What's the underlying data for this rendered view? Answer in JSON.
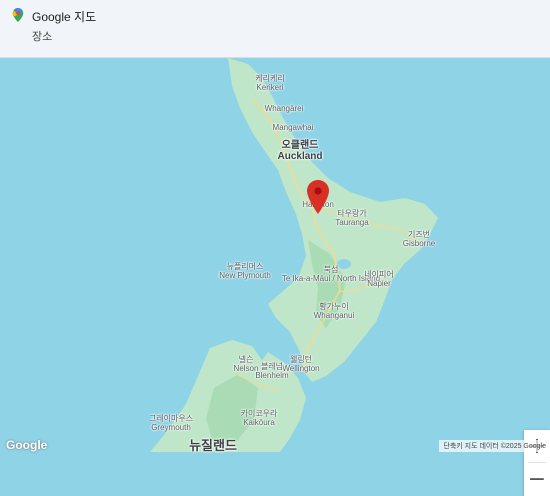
{
  "header": {
    "title": "Google 지도",
    "subtitle": "장소",
    "logo_icon": "google-maps-pin-icon"
  },
  "map": {
    "marker": {
      "label": "Hamilton"
    },
    "places": [
      {
        "id": "kerikeri",
        "name_ko": "케리케리",
        "name_en": "Kerikeri"
      },
      {
        "id": "whangarei",
        "name_ko": "",
        "name_en": "Whangārei"
      },
      {
        "id": "mangawhai",
        "name_ko": "",
        "name_en": "Mangawhai"
      },
      {
        "id": "auckland",
        "name_ko": "오클랜드",
        "name_en": "Auckland"
      },
      {
        "id": "hamilton",
        "name_ko": "",
        "name_en": "Hamilton"
      },
      {
        "id": "tauranga",
        "name_ko": "타우랑가",
        "name_en": "Tauranga"
      },
      {
        "id": "gisborne",
        "name_ko": "기즈번",
        "name_en": "Gisborne"
      },
      {
        "id": "new-plymouth",
        "name_ko": "뉴플리머스",
        "name_en": "New Plymouth"
      },
      {
        "id": "north-island",
        "name_ko": "북섬",
        "name_en": "Te Ika-a-Māui / North Island"
      },
      {
        "id": "napier",
        "name_ko": "네이피어",
        "name_en": "Napier"
      },
      {
        "id": "whanganui",
        "name_ko": "황가누이",
        "name_en": "Whanganui"
      },
      {
        "id": "nelson",
        "name_ko": "넬슨",
        "name_en": "Nelson"
      },
      {
        "id": "wellington",
        "name_ko": "웰링턴",
        "name_en": "Wellington"
      },
      {
        "id": "blenheim",
        "name_ko": "블레넘",
        "name_en": "Blenheim"
      },
      {
        "id": "greymouth",
        "name_ko": "그레이마우스",
        "name_en": "Greymouth"
      },
      {
        "id": "kaikoura",
        "name_ko": "카이코우라",
        "name_en": "Kaikōura"
      },
      {
        "id": "new-zealand",
        "name_ko": "뉴질랜드",
        "name_en": ""
      }
    ],
    "controls": {
      "zoom_in": "+",
      "zoom_out": "−"
    },
    "logo": "Google",
    "attribution": "단축키  지도 데이터 ©2025 Google"
  },
  "colors": {
    "water": "#8fd3e6",
    "land": "#bfe6c9",
    "marker": "#d93025",
    "header_bg": "#f1f4f9"
  }
}
